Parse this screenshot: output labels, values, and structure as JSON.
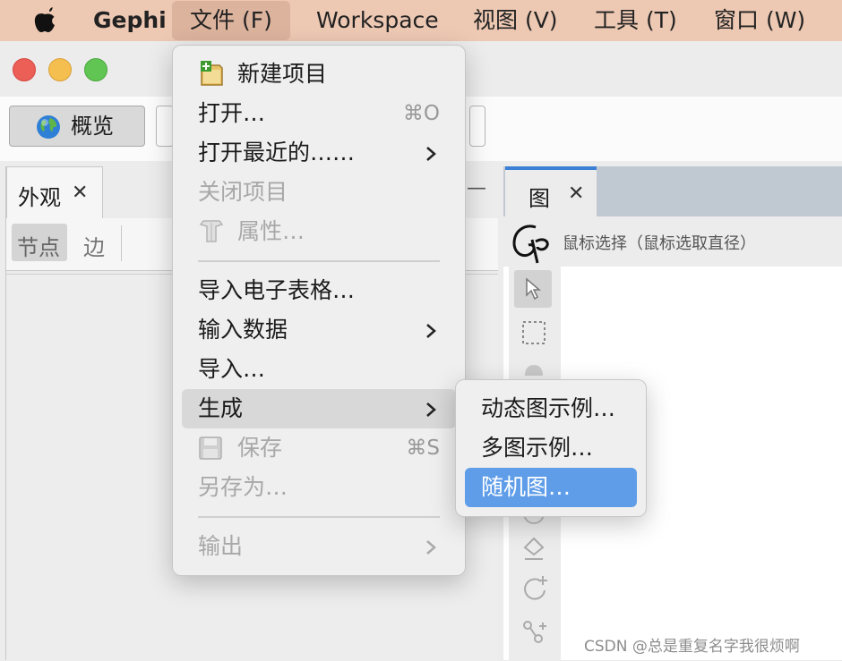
{
  "menubar": {
    "app_name": "Gephi",
    "items": [
      {
        "label": "文件 (F)"
      },
      {
        "label": "Workspace"
      },
      {
        "label": "视图 (V)"
      },
      {
        "label": "工具 (T)"
      },
      {
        "label": "窗口 (W)"
      }
    ]
  },
  "window": {
    "traffic_lights": {
      "close": "#ec5f57",
      "minimize": "#f5bf4f",
      "zoom": "#61c554"
    },
    "toolbar": {
      "overview_label": "概览"
    }
  },
  "left_panel": {
    "tab_label": "外观",
    "tab_close": "✕",
    "subtabs": [
      {
        "label": "节点"
      },
      {
        "label": "边"
      }
    ],
    "minimize_glyph": "—"
  },
  "graph_panel": {
    "tab_label": "图",
    "tab_close": "✕",
    "status_text": "鼠标选择（鼠标选取直径）",
    "tools": [
      "cursor-icon",
      "rect-select-icon",
      "drag-icon",
      "rotate-icon",
      "paint-icon",
      "add-node-icon",
      "add-edge-icon"
    ]
  },
  "file_menu": {
    "items": [
      {
        "label": "新建项目",
        "icon": "new-project-icon",
        "enabled": true
      },
      {
        "label": "打开…",
        "shortcut": "⌘O",
        "enabled": true
      },
      {
        "label": "打开最近的……",
        "submenu": true,
        "enabled": true
      },
      {
        "label": "关闭项目",
        "enabled": false
      },
      {
        "label": "属性…",
        "icon": "properties-icon",
        "enabled": false
      },
      {
        "label": "导入电子表格…",
        "enabled": true
      },
      {
        "label": "输入数据",
        "submenu": true,
        "enabled": true
      },
      {
        "label": "导入…",
        "enabled": true
      },
      {
        "label": "生成",
        "submenu": true,
        "enabled": true,
        "highlighted": true
      },
      {
        "label": "保存",
        "icon": "save-icon",
        "shortcut": "⌘S",
        "enabled": false
      },
      {
        "label": "另存为…",
        "enabled": false
      },
      {
        "label": "输出",
        "submenu": true,
        "enabled": false
      }
    ]
  },
  "generate_submenu": {
    "items": [
      {
        "label": "动态图示例…"
      },
      {
        "label": "多图示例…"
      },
      {
        "label": "随机图…",
        "highlighted": true
      }
    ],
    "highlight_color": "#5f9de9"
  },
  "watermark": "CSDN @总是重复名字我很烦啊"
}
